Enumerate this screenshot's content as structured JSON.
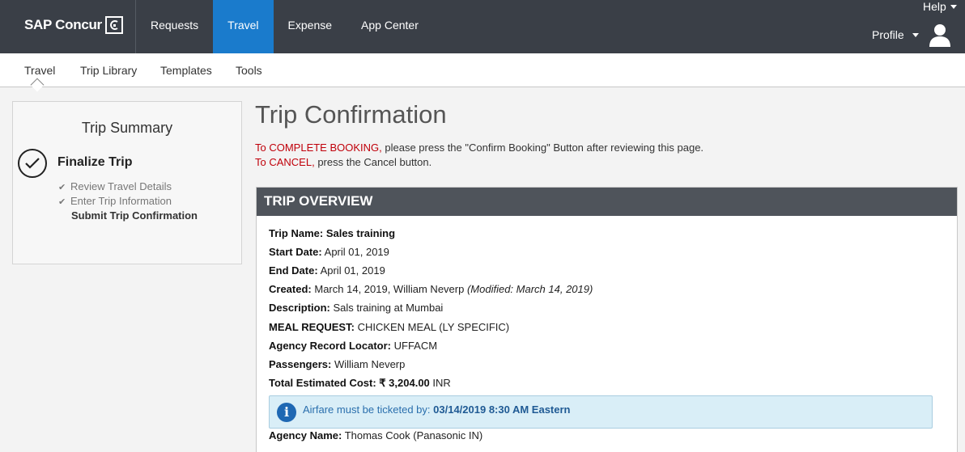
{
  "header": {
    "logo_text": "SAP Concur",
    "nav": [
      "Requests",
      "Travel",
      "Expense",
      "App Center"
    ],
    "active_nav": "Travel",
    "help_label": "Help",
    "profile_label": "Profile"
  },
  "subnav": {
    "items": [
      "Travel",
      "Trip Library",
      "Templates",
      "Tools"
    ]
  },
  "summary": {
    "title": "Trip Summary",
    "current_step": "Finalize Trip",
    "steps": [
      "Review Travel Details",
      "Enter Trip Information",
      "Submit Trip Confirmation"
    ]
  },
  "main": {
    "title": "Trip Confirmation",
    "complete_red": "To COMPLETE BOOKING,",
    "complete_rest": " please press the \"Confirm Booking\" Button after reviewing this page.",
    "cancel_red": "To CANCEL,",
    "cancel_rest": " press the Cancel button."
  },
  "overview": {
    "heading": "TRIP OVERVIEW",
    "trip_name_label": "Trip Name:",
    "trip_name": "Sales training",
    "start_label": "Start Date:",
    "start": "April 01, 2019",
    "end_label": "End Date:",
    "end": "April 01, 2019",
    "created_label": "Created:",
    "created": "March 14, 2019, William Neverp",
    "modified": "(Modified: March 14, 2019)",
    "desc_label": "Description:",
    "desc": "Sals training at Mumbai",
    "meal_label": "MEAL REQUEST:",
    "meal": "CHICKEN MEAL (LY SPECIFIC)",
    "locator_label": "Agency Record Locator:",
    "locator": "UFFACM",
    "passengers_label": "Passengers:",
    "passengers": "William Neverp",
    "cost_label": "Total Estimated Cost:",
    "cost_value": "₹ 3,204.00",
    "cost_currency": "INR",
    "alert_text": "Airfare must be ticketed by:",
    "alert_deadline": "03/14/2019 8:30 AM Eastern",
    "agency_label": "Agency Name:",
    "agency": "Thomas Cook (Panasonic IN)"
  },
  "colors": {
    "topbar": "#3a3f47",
    "active_tab": "#1a7bcc",
    "red_text": "#c0000a",
    "overview_header": "#4f545b",
    "alert_bg": "#d9eef7"
  }
}
